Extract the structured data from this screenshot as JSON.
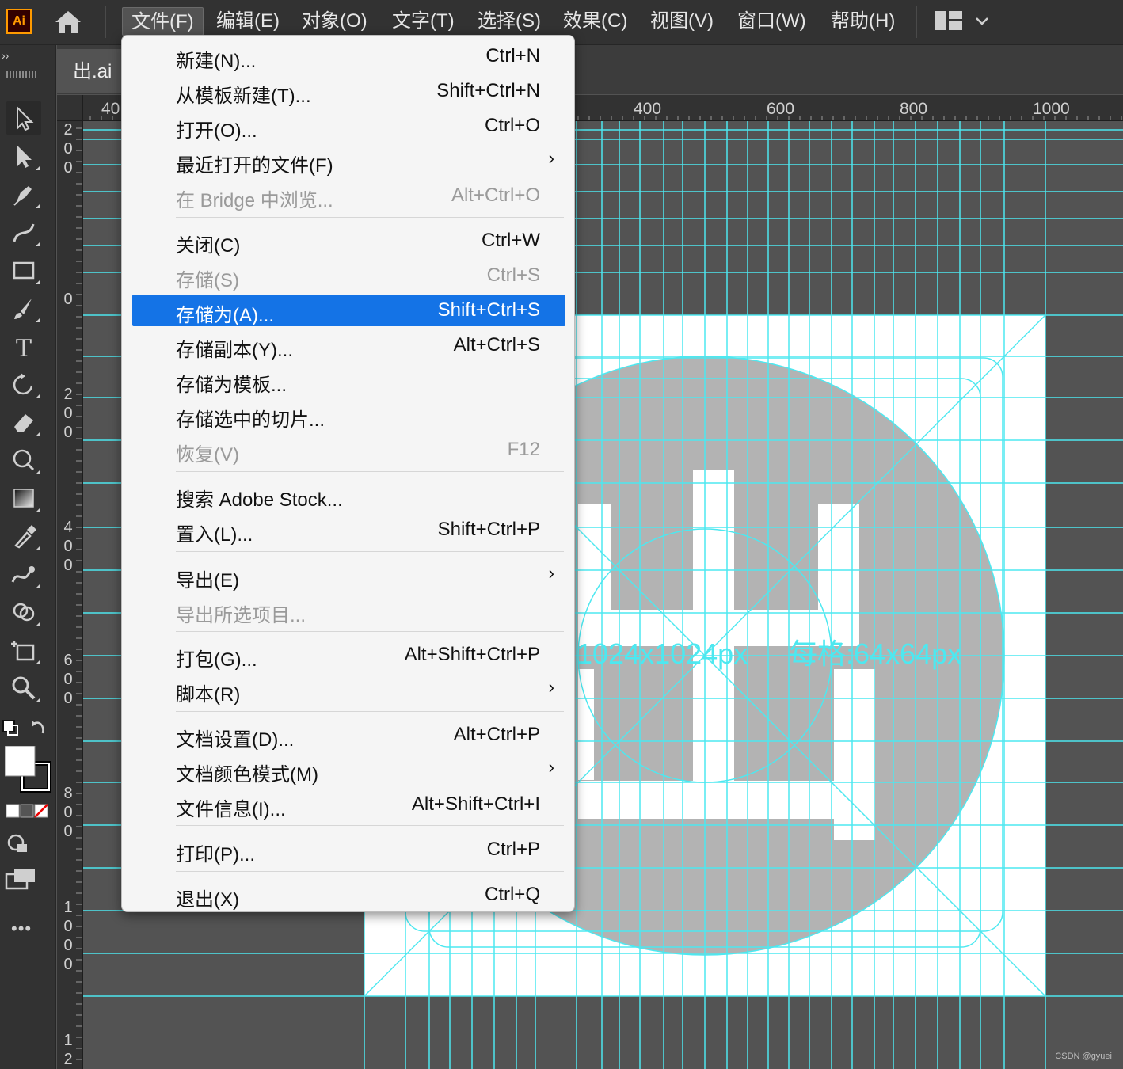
{
  "app": {
    "logo_text": "Ai",
    "document_tab": "出.ai",
    "watermark": "CSDN @gyuei"
  },
  "menubar": {
    "items": [
      {
        "label": "文件(F)",
        "active": true
      },
      {
        "label": "编辑(E)"
      },
      {
        "label": "对象(O)"
      },
      {
        "label": "文字(T)"
      },
      {
        "label": "选择(S)"
      },
      {
        "label": "效果(C)"
      },
      {
        "label": "视图(V)"
      },
      {
        "label": "窗口(W)"
      },
      {
        "label": "帮助(H)"
      }
    ]
  },
  "toolbar": {
    "collapse_glyph": "››",
    "tools": [
      "selection-tool-icon",
      "direct-selection-tool-icon",
      "pen-tool-icon",
      "curvature-tool-icon",
      "rectangle-tool-icon",
      "paintbrush-tool-icon",
      "type-tool-icon",
      "rotate-tool-icon",
      "eraser-tool-icon",
      "puppet-warp-tool-icon",
      "gradient-tool-icon",
      "eyedropper-tool-icon",
      "blend-tool-icon",
      "shape-builder-tool-icon",
      "artboard-tool-icon",
      "zoom-tool-icon"
    ],
    "more_glyph": "•••"
  },
  "ruler_top": {
    "labels": [
      "40",
      "400",
      "600",
      "800",
      "1000"
    ]
  },
  "ruler_left": {
    "labels": [
      "200",
      "0",
      "200",
      "400",
      "600",
      "800",
      "1000",
      "12"
    ]
  },
  "artboard": {
    "text_size": "1024x1024px",
    "text_grid": "每格:64x64px",
    "guide_color": "#4de8f0",
    "glyph_color": "#b3b3b3"
  },
  "file_menu": {
    "items": [
      {
        "label": "新建(N)...",
        "shortcut": "Ctrl+N"
      },
      {
        "label": "从模板新建(T)...",
        "shortcut": "Shift+Ctrl+N"
      },
      {
        "label": "打开(O)...",
        "shortcut": "Ctrl+O"
      },
      {
        "label": "最近打开的文件(F)",
        "shortcut": "",
        "submenu": true
      },
      {
        "label": "在 Bridge 中浏览...",
        "shortcut": "Alt+Ctrl+O",
        "disabled": true
      },
      {
        "label": "关闭(C)",
        "shortcut": "Ctrl+W"
      },
      {
        "label": "存储(S)",
        "shortcut": "Ctrl+S",
        "disabled": true
      },
      {
        "label": "存储为(A)...",
        "shortcut": "Shift+Ctrl+S",
        "highlighted": true
      },
      {
        "label": "存储副本(Y)...",
        "shortcut": "Alt+Ctrl+S"
      },
      {
        "label": "存储为模板...",
        "shortcut": ""
      },
      {
        "label": "存储选中的切片...",
        "shortcut": ""
      },
      {
        "label": "恢复(V)",
        "shortcut": "F12",
        "disabled": true
      },
      {
        "label": "搜索 Adobe Stock...",
        "shortcut": ""
      },
      {
        "label": "置入(L)...",
        "shortcut": "Shift+Ctrl+P"
      },
      {
        "label": "导出(E)",
        "shortcut": "",
        "submenu": true
      },
      {
        "label": "导出所选项目...",
        "shortcut": "",
        "disabled": true
      },
      {
        "label": "打包(G)...",
        "shortcut": "Alt+Shift+Ctrl+P"
      },
      {
        "label": "脚本(R)",
        "shortcut": "",
        "submenu": true
      },
      {
        "label": "文档设置(D)...",
        "shortcut": "Alt+Ctrl+P"
      },
      {
        "label": "文档颜色模式(M)",
        "shortcut": "",
        "submenu": true
      },
      {
        "label": "文件信息(I)...",
        "shortcut": "Alt+Shift+Ctrl+I"
      },
      {
        "label": "打印(P)...",
        "shortcut": "Ctrl+P"
      },
      {
        "label": "退出(X)",
        "shortcut": "Ctrl+Q"
      }
    ],
    "submenu_glyph": "›"
  }
}
